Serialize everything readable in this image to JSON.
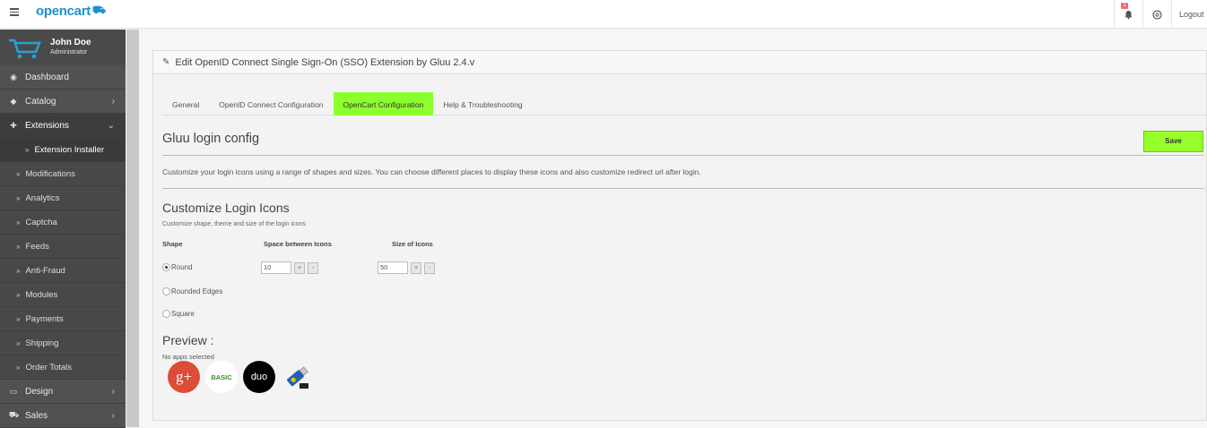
{
  "header": {
    "logo": "opencart",
    "notification_count": "1",
    "logout_label": "Logout"
  },
  "user": {
    "name": "John Doe",
    "role": "Administrator"
  },
  "sidebar": {
    "items": [
      {
        "label": "Dashboard",
        "icon": "dashboard-icon"
      },
      {
        "label": "Catalog",
        "icon": "tags-icon"
      },
      {
        "label": "Extensions",
        "icon": "puzzle-icon"
      }
    ],
    "sub_items": [
      {
        "label": "Extension Installer"
      },
      {
        "label": "Modifications"
      },
      {
        "label": "Analytics"
      },
      {
        "label": "Captcha"
      },
      {
        "label": "Feeds"
      },
      {
        "label": "Anti-Fraud"
      },
      {
        "label": "Modules"
      },
      {
        "label": "Payments"
      },
      {
        "label": "Shipping"
      },
      {
        "label": "Order Totals"
      }
    ],
    "bottom_items": [
      {
        "label": "Design",
        "icon": "television-icon"
      },
      {
        "label": "Sales",
        "icon": "shopping-cart-icon"
      }
    ]
  },
  "panel": {
    "title": "Edit OpenID Connect Single Sign-On (SSO) Extension by Gluu 2.4.v",
    "tabs": [
      {
        "label": "General"
      },
      {
        "label": "OpenID Connect Configuration"
      },
      {
        "label": "OpenCart Configuration"
      },
      {
        "label": "Help & Troubleshooting"
      }
    ],
    "section_title": "Gluu login config",
    "save_label": "Save",
    "description": "Customize your login icons using a range of shapes and sizes. You can choose different places to display these icons and also customize redirect url after login.",
    "customize_title": "Customize Login Icons",
    "customize_desc": "Customize shape, theme and size of the login icons",
    "shape_label": "Shape",
    "space_label": "Space between Icons",
    "size_label": "Size of Icons",
    "shapes": [
      {
        "label": "Round",
        "selected": true
      },
      {
        "label": "Rounded Edges",
        "selected": false
      },
      {
        "label": "Square",
        "selected": false
      }
    ],
    "space_value": "10",
    "size_value": "50",
    "plus": "+",
    "minus": "-",
    "preview_title": "Preview :",
    "no_apps": "No apps selected",
    "preview_icons": [
      "google-plus-icon",
      "basic-icon",
      "duo-icon",
      "u2f-key-icon"
    ],
    "icon_texts": {
      "google": "g+",
      "basic": "BASIC",
      "duo": "duo"
    }
  },
  "colors": {
    "accent_green": "#8cff2e",
    "brand_blue": "#1e91cf",
    "sidebar": "#515151"
  }
}
